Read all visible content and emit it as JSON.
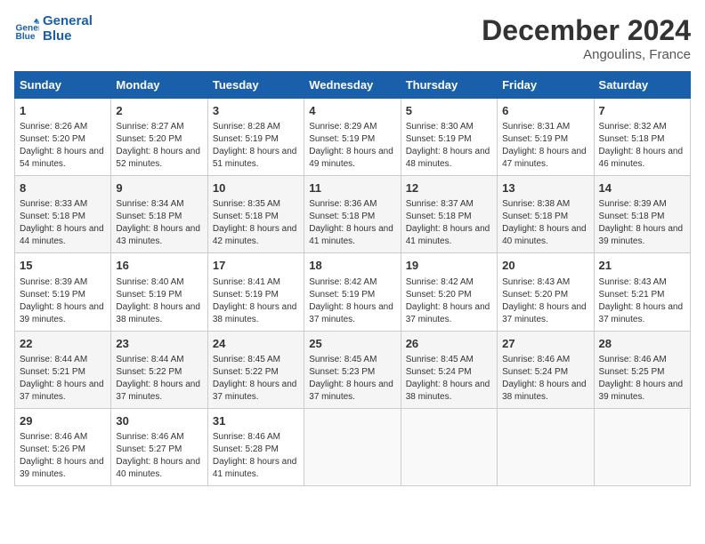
{
  "header": {
    "logo_line1": "General",
    "logo_line2": "Blue",
    "month": "December 2024",
    "location": "Angoulins, France"
  },
  "days_of_week": [
    "Sunday",
    "Monday",
    "Tuesday",
    "Wednesday",
    "Thursday",
    "Friday",
    "Saturday"
  ],
  "weeks": [
    [
      {
        "day": "1",
        "sunrise": "Sunrise: 8:26 AM",
        "sunset": "Sunset: 5:20 PM",
        "daylight": "Daylight: 8 hours and 54 minutes."
      },
      {
        "day": "2",
        "sunrise": "Sunrise: 8:27 AM",
        "sunset": "Sunset: 5:20 PM",
        "daylight": "Daylight: 8 hours and 52 minutes."
      },
      {
        "day": "3",
        "sunrise": "Sunrise: 8:28 AM",
        "sunset": "Sunset: 5:19 PM",
        "daylight": "Daylight: 8 hours and 51 minutes."
      },
      {
        "day": "4",
        "sunrise": "Sunrise: 8:29 AM",
        "sunset": "Sunset: 5:19 PM",
        "daylight": "Daylight: 8 hours and 49 minutes."
      },
      {
        "day": "5",
        "sunrise": "Sunrise: 8:30 AM",
        "sunset": "Sunset: 5:19 PM",
        "daylight": "Daylight: 8 hours and 48 minutes."
      },
      {
        "day": "6",
        "sunrise": "Sunrise: 8:31 AM",
        "sunset": "Sunset: 5:19 PM",
        "daylight": "Daylight: 8 hours and 47 minutes."
      },
      {
        "day": "7",
        "sunrise": "Sunrise: 8:32 AM",
        "sunset": "Sunset: 5:18 PM",
        "daylight": "Daylight: 8 hours and 46 minutes."
      }
    ],
    [
      {
        "day": "8",
        "sunrise": "Sunrise: 8:33 AM",
        "sunset": "Sunset: 5:18 PM",
        "daylight": "Daylight: 8 hours and 44 minutes."
      },
      {
        "day": "9",
        "sunrise": "Sunrise: 8:34 AM",
        "sunset": "Sunset: 5:18 PM",
        "daylight": "Daylight: 8 hours and 43 minutes."
      },
      {
        "day": "10",
        "sunrise": "Sunrise: 8:35 AM",
        "sunset": "Sunset: 5:18 PM",
        "daylight": "Daylight: 8 hours and 42 minutes."
      },
      {
        "day": "11",
        "sunrise": "Sunrise: 8:36 AM",
        "sunset": "Sunset: 5:18 PM",
        "daylight": "Daylight: 8 hours and 41 minutes."
      },
      {
        "day": "12",
        "sunrise": "Sunrise: 8:37 AM",
        "sunset": "Sunset: 5:18 PM",
        "daylight": "Daylight: 8 hours and 41 minutes."
      },
      {
        "day": "13",
        "sunrise": "Sunrise: 8:38 AM",
        "sunset": "Sunset: 5:18 PM",
        "daylight": "Daylight: 8 hours and 40 minutes."
      },
      {
        "day": "14",
        "sunrise": "Sunrise: 8:39 AM",
        "sunset": "Sunset: 5:18 PM",
        "daylight": "Daylight: 8 hours and 39 minutes."
      }
    ],
    [
      {
        "day": "15",
        "sunrise": "Sunrise: 8:39 AM",
        "sunset": "Sunset: 5:19 PM",
        "daylight": "Daylight: 8 hours and 39 minutes."
      },
      {
        "day": "16",
        "sunrise": "Sunrise: 8:40 AM",
        "sunset": "Sunset: 5:19 PM",
        "daylight": "Daylight: 8 hours and 38 minutes."
      },
      {
        "day": "17",
        "sunrise": "Sunrise: 8:41 AM",
        "sunset": "Sunset: 5:19 PM",
        "daylight": "Daylight: 8 hours and 38 minutes."
      },
      {
        "day": "18",
        "sunrise": "Sunrise: 8:42 AM",
        "sunset": "Sunset: 5:19 PM",
        "daylight": "Daylight: 8 hours and 37 minutes."
      },
      {
        "day": "19",
        "sunrise": "Sunrise: 8:42 AM",
        "sunset": "Sunset: 5:20 PM",
        "daylight": "Daylight: 8 hours and 37 minutes."
      },
      {
        "day": "20",
        "sunrise": "Sunrise: 8:43 AM",
        "sunset": "Sunset: 5:20 PM",
        "daylight": "Daylight: 8 hours and 37 minutes."
      },
      {
        "day": "21",
        "sunrise": "Sunrise: 8:43 AM",
        "sunset": "Sunset: 5:21 PM",
        "daylight": "Daylight: 8 hours and 37 minutes."
      }
    ],
    [
      {
        "day": "22",
        "sunrise": "Sunrise: 8:44 AM",
        "sunset": "Sunset: 5:21 PM",
        "daylight": "Daylight: 8 hours and 37 minutes."
      },
      {
        "day": "23",
        "sunrise": "Sunrise: 8:44 AM",
        "sunset": "Sunset: 5:22 PM",
        "daylight": "Daylight: 8 hours and 37 minutes."
      },
      {
        "day": "24",
        "sunrise": "Sunrise: 8:45 AM",
        "sunset": "Sunset: 5:22 PM",
        "daylight": "Daylight: 8 hours and 37 minutes."
      },
      {
        "day": "25",
        "sunrise": "Sunrise: 8:45 AM",
        "sunset": "Sunset: 5:23 PM",
        "daylight": "Daylight: 8 hours and 37 minutes."
      },
      {
        "day": "26",
        "sunrise": "Sunrise: 8:45 AM",
        "sunset": "Sunset: 5:24 PM",
        "daylight": "Daylight: 8 hours and 38 minutes."
      },
      {
        "day": "27",
        "sunrise": "Sunrise: 8:46 AM",
        "sunset": "Sunset: 5:24 PM",
        "daylight": "Daylight: 8 hours and 38 minutes."
      },
      {
        "day": "28",
        "sunrise": "Sunrise: 8:46 AM",
        "sunset": "Sunset: 5:25 PM",
        "daylight": "Daylight: 8 hours and 39 minutes."
      }
    ],
    [
      {
        "day": "29",
        "sunrise": "Sunrise: 8:46 AM",
        "sunset": "Sunset: 5:26 PM",
        "daylight": "Daylight: 8 hours and 39 minutes."
      },
      {
        "day": "30",
        "sunrise": "Sunrise: 8:46 AM",
        "sunset": "Sunset: 5:27 PM",
        "daylight": "Daylight: 8 hours and 40 minutes."
      },
      {
        "day": "31",
        "sunrise": "Sunrise: 8:46 AM",
        "sunset": "Sunset: 5:28 PM",
        "daylight": "Daylight: 8 hours and 41 minutes."
      },
      null,
      null,
      null,
      null
    ]
  ]
}
